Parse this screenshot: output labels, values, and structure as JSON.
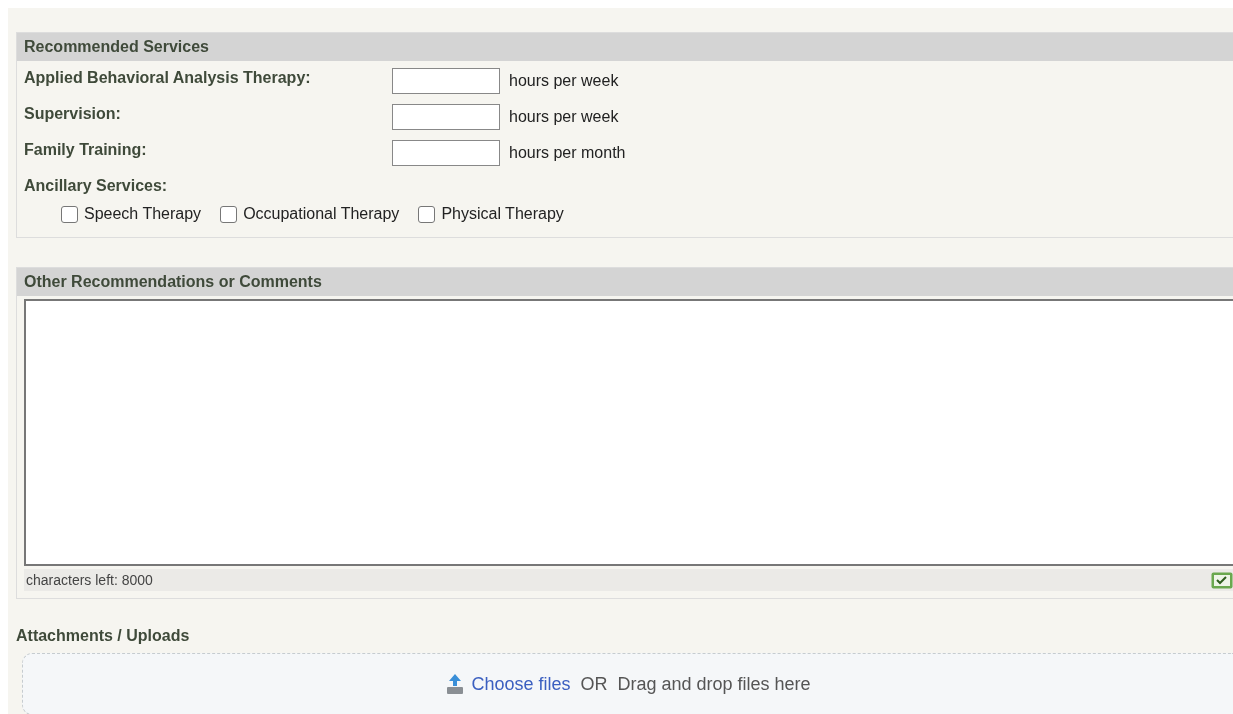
{
  "recommended_services": {
    "title": "Recommended Services",
    "fields": [
      {
        "label": "Applied Behavioral Analysis Therapy:",
        "unit": "hours per week"
      },
      {
        "label": "Supervision:",
        "unit": "hours per week"
      },
      {
        "label": "Family Training:",
        "unit": "hours per month"
      }
    ],
    "ancillary_label": "Ancillary Services:",
    "ancillary": [
      {
        "label": "Speech Therapy",
        "checked": false
      },
      {
        "label": "Occupational Therapy",
        "checked": false
      },
      {
        "label": "Physical Therapy",
        "checked": false
      }
    ]
  },
  "comments": {
    "title": "Other Recommendations or Comments",
    "counter": "characters left:  8000"
  },
  "attachments": {
    "title": "Attachments / Uploads",
    "choose": "Choose files",
    "or": "OR",
    "drop": "Drag and drop files here"
  }
}
